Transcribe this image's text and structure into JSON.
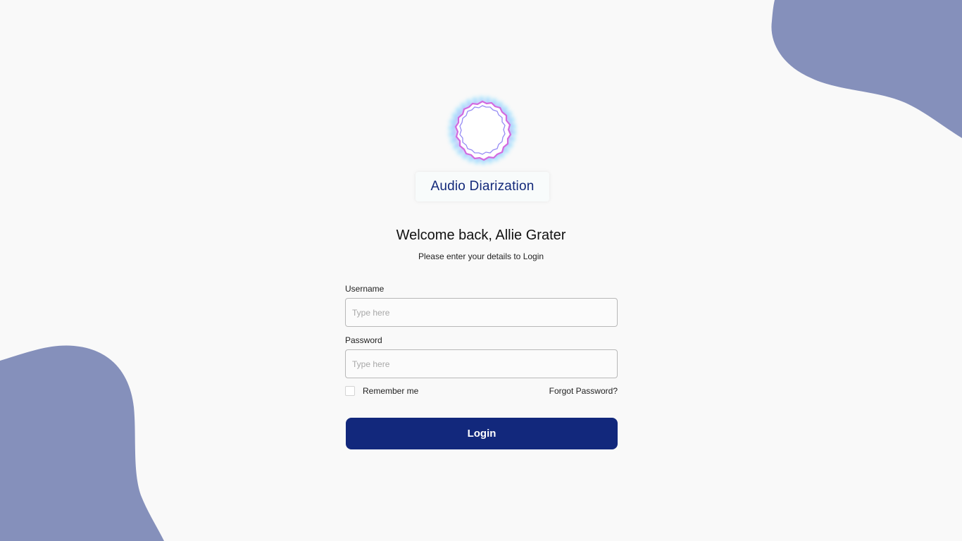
{
  "brand": {
    "name": "Audio Diarization",
    "logo_icon": "sound-wave-ring-icon",
    "color": "#13297a"
  },
  "login": {
    "welcome": "Welcome back, Allie Grater",
    "subtitle": "Please enter your details to Login",
    "username": {
      "label": "Username",
      "placeholder": "Type here",
      "value": ""
    },
    "password": {
      "label": "Password",
      "placeholder": "Type here",
      "value": ""
    },
    "remember_me": {
      "label": "Remember me",
      "checked": false
    },
    "forgot_password": "Forgot Password?",
    "submit_label": "Login"
  },
  "colors": {
    "accent": "#12287c",
    "blob": "#8590bb",
    "background": "#f9f9f9"
  }
}
